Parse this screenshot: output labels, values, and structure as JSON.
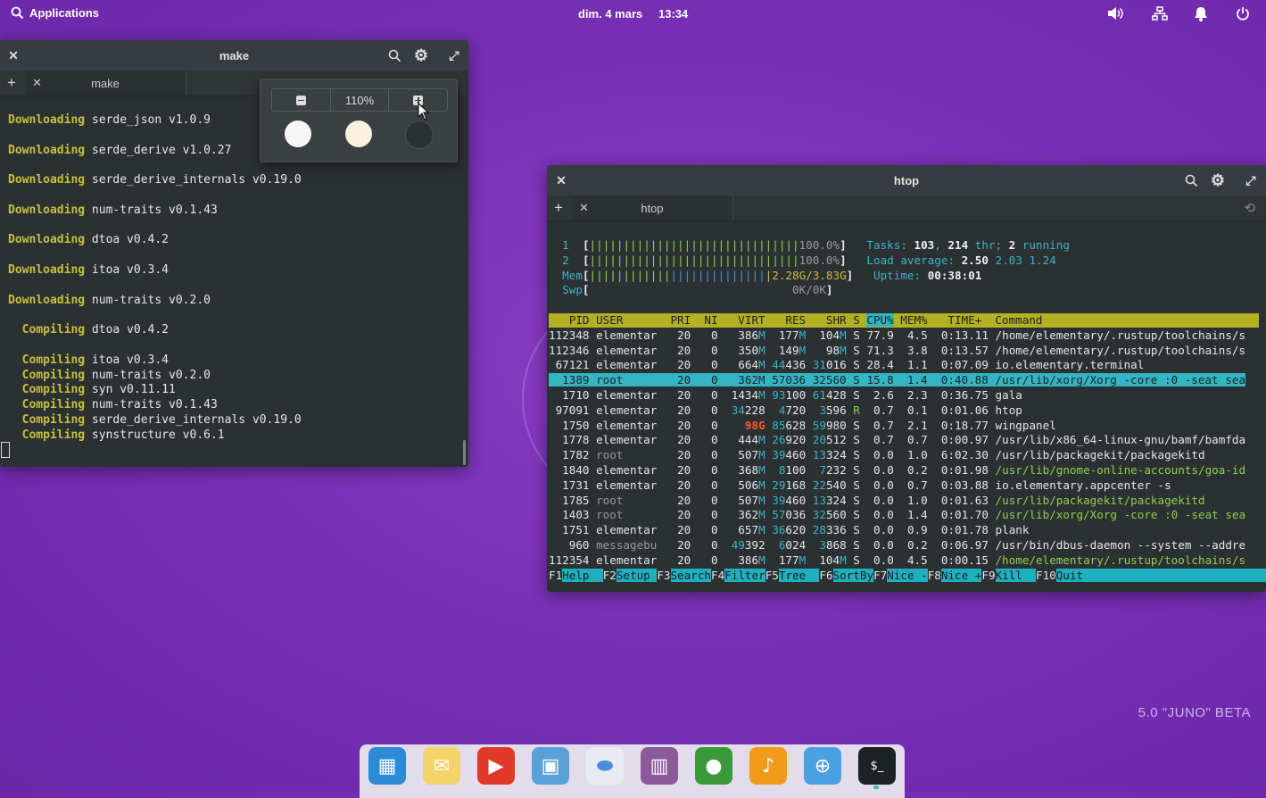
{
  "panel": {
    "applications": "Applications",
    "date": "dim. 4 mars",
    "time": "13:34"
  },
  "watermark": "5.0 \"JUNO\" BETA",
  "make_window": {
    "title": "make",
    "tab_label": "make",
    "zoom_value": "110%",
    "lines": [
      {
        "kw": "Downloading",
        "rest": " serde_json v1.0.9"
      },
      {
        "kw": "",
        "rest": ""
      },
      {
        "kw": "Downloading",
        "rest": " serde_derive v1.0.27"
      },
      {
        "kw": "",
        "rest": ""
      },
      {
        "kw": "Downloading",
        "rest": " serde_derive_internals v0.19.0"
      },
      {
        "kw": "",
        "rest": ""
      },
      {
        "kw": "Downloading",
        "rest": " num-traits v0.1.43"
      },
      {
        "kw": "",
        "rest": ""
      },
      {
        "kw": "Downloading",
        "rest": " dtoa v0.4.2"
      },
      {
        "kw": "",
        "rest": ""
      },
      {
        "kw": "Downloading",
        "rest": " itoa v0.3.4"
      },
      {
        "kw": "",
        "rest": ""
      },
      {
        "kw": "Downloading",
        "rest": " num-traits v0.2.0"
      },
      {
        "kw": "",
        "rest": ""
      },
      {
        "kw": "  Compiling",
        "rest": " dtoa v0.4.2"
      },
      {
        "kw": "",
        "rest": ""
      },
      {
        "kw": "  Compiling",
        "rest": " itoa v0.3.4"
      },
      {
        "kw": "  Compiling",
        "rest": " num-traits v0.2.0"
      },
      {
        "kw": "  Compiling",
        "rest": " syn v0.11.11"
      },
      {
        "kw": "  Compiling",
        "rest": " num-traits v0.1.43"
      },
      {
        "kw": "  Compiling",
        "rest": " serde_derive_internals v0.19.0"
      },
      {
        "kw": "  Compiling",
        "rest": " synstructure v0.6.1"
      }
    ],
    "swatches": [
      "#f7f7f7",
      "#fbf1dd",
      "#2b3033"
    ]
  },
  "htop_window": {
    "title": "htop",
    "tab_label": "htop",
    "cpu1": {
      "num": "1",
      "bars": "|||||||||||||||||||||||||||||||",
      "val": "100.0%"
    },
    "cpu2": {
      "num": "2",
      "bars": "|||||||||||||||||||||||||||||||",
      "val": "100.0%"
    },
    "mem": {
      "label": "Mem",
      "bars": "||||||||||||||||||||||||||",
      "val": "2.28G/3.83G"
    },
    "swp": {
      "label": "Swp",
      "val": "0K/0K"
    },
    "tasks": {
      "label": "Tasks: ",
      "n1": "103",
      "sep": ", ",
      "n2": "214",
      "thr": " thr; ",
      "n3": "2",
      "run": " running"
    },
    "load": {
      "label": "Load average: ",
      "a": "2.50",
      "b": "2.03",
      "c": "1.24"
    },
    "uptime": {
      "label": "Uptime: ",
      "val": "00:38:01"
    },
    "columns": {
      "pid": "PID",
      "user": "USER",
      "pri": "PRI",
      "ni": "NI",
      "virt": "VIRT",
      "res": "RES",
      "shr": "SHR",
      "s": "S",
      "cpu": "CPU%",
      "mem": "MEM%",
      "time": "TIME+",
      "cmd": "Command"
    },
    "rows": [
      {
        "pid": "112348",
        "user": "elementar",
        "pri": "20",
        "ni": "0",
        "virt": "386M",
        "res": "177M",
        "shr": "104M",
        "s": "S",
        "cpu": "77.9",
        "mem": "4.5",
        "time": "0:13.11",
        "cmd": "/home/elementary/.rustup/toolchains/s",
        "root": false
      },
      {
        "pid": "112346",
        "user": "elementar",
        "pri": "20",
        "ni": "0",
        "virt": "350M",
        "res": "149M",
        "shr": "98M",
        "s": "S",
        "cpu": "71.3",
        "mem": "3.8",
        "time": "0:13.57",
        "cmd": "/home/elementary/.rustup/toolchains/s",
        "root": false
      },
      {
        "pid": "67121",
        "user": "elementar",
        "pri": "20",
        "ni": "0",
        "virt": "664M",
        "res": "44436",
        "shr": "31016",
        "s": "S",
        "cpu": "28.4",
        "mem": "1.1",
        "time": "0:07.09",
        "cmd": "io.elementary.terminal",
        "root": false
      },
      {
        "pid": "1389",
        "user": "root",
        "pri": "20",
        "ni": "0",
        "virt": "362M",
        "res": "57036",
        "shr": "32560",
        "s": "S",
        "cpu": "15.8",
        "mem": "1.4",
        "time": "0:40.88",
        "cmd": "/usr/lib/xorg/Xorg -core :0 -seat sea",
        "root": true,
        "selected": true
      },
      {
        "pid": "1710",
        "user": "elementar",
        "pri": "20",
        "ni": "0",
        "virt": "1434M",
        "res": "93100",
        "shr": "61428",
        "s": "S",
        "cpu": "2.6",
        "mem": "2.3",
        "time": "0:36.75",
        "cmd": "gala",
        "root": false
      },
      {
        "pid": "97091",
        "user": "elementar",
        "pri": "20",
        "ni": "0",
        "virt": "34228",
        "res": "4720",
        "shr": "3596",
        "s": "R",
        "cpu": "0.7",
        "mem": "0.1",
        "time": "0:01.06",
        "cmd": "htop",
        "root": false
      },
      {
        "pid": "1750",
        "user": "elementar",
        "pri": "20",
        "ni": "0",
        "virt": "98G",
        "res": "85628",
        "shr": "59980",
        "s": "S",
        "cpu": "0.7",
        "mem": "2.1",
        "time": "0:18.77",
        "cmd": "wingpanel",
        "root": false,
        "bigvirt": true
      },
      {
        "pid": "1778",
        "user": "elementar",
        "pri": "20",
        "ni": "0",
        "virt": "444M",
        "res": "26920",
        "shr": "20512",
        "s": "S",
        "cpu": "0.7",
        "mem": "0.7",
        "time": "0:00.97",
        "cmd": "/usr/lib/x86_64-linux-gnu/bamf/bamfda",
        "root": false
      },
      {
        "pid": "1782",
        "user": "root",
        "pri": "20",
        "ni": "0",
        "virt": "507M",
        "res": "39460",
        "shr": "13324",
        "s": "S",
        "cpu": "0.0",
        "mem": "1.0",
        "time": "6:02.30",
        "cmd": "/usr/lib/packagekit/packagekitd",
        "root": true
      },
      {
        "pid": "1840",
        "user": "elementar",
        "pri": "20",
        "ni": "0",
        "virt": "368M",
        "res": "8100",
        "shr": "7232",
        "s": "S",
        "cpu": "0.0",
        "mem": "0.2",
        "time": "0:01.98",
        "cmd": "/usr/lib/gnome-online-accounts/goa-id",
        "root": false,
        "greencmd": true
      },
      {
        "pid": "1731",
        "user": "elementar",
        "pri": "20",
        "ni": "0",
        "virt": "506M",
        "res": "29168",
        "shr": "22540",
        "s": "S",
        "cpu": "0.0",
        "mem": "0.7",
        "time": "0:03.88",
        "cmd": "io.elementary.appcenter -s",
        "root": false
      },
      {
        "pid": "1785",
        "user": "root",
        "pri": "20",
        "ni": "0",
        "virt": "507M",
        "res": "39460",
        "shr": "13324",
        "s": "S",
        "cpu": "0.0",
        "mem": "1.0",
        "time": "0:01.63",
        "cmd": "/usr/lib/packagekit/packagekitd",
        "root": true,
        "greencmd": true
      },
      {
        "pid": "1403",
        "user": "root",
        "pri": "20",
        "ni": "0",
        "virt": "362M",
        "res": "57036",
        "shr": "32560",
        "s": "S",
        "cpu": "0.0",
        "mem": "1.4",
        "time": "0:01.70",
        "cmd": "/usr/lib/xorg/Xorg -core :0 -seat sea",
        "root": true,
        "greencmd": true
      },
      {
        "pid": "1751",
        "user": "elementar",
        "pri": "20",
        "ni": "0",
        "virt": "657M",
        "res": "36620",
        "shr": "28336",
        "s": "S",
        "cpu": "0.0",
        "mem": "0.9",
        "time": "0:01.78",
        "cmd": "plank",
        "root": false
      },
      {
        "pid": "960",
        "user": "messagebu",
        "pri": "20",
        "ni": "0",
        "virt": "49392",
        "res": "6024",
        "shr": "3868",
        "s": "S",
        "cpu": "0.0",
        "mem": "0.2",
        "time": "0:06.97",
        "cmd": "/usr/bin/dbus-daemon --system --addre",
        "root": true
      },
      {
        "pid": "112354",
        "user": "elementar",
        "pri": "20",
        "ni": "0",
        "virt": "386M",
        "res": "177M",
        "shr": "104M",
        "s": "S",
        "cpu": "0.0",
        "mem": "4.5",
        "time": "0:00.15",
        "cmd": "/home/elementary/.rustup/toolchains/s",
        "root": false,
        "greencmd": true
      }
    ],
    "fkeys": [
      {
        "k": "F1",
        "l": "Help  "
      },
      {
        "k": "F2",
        "l": "Setup "
      },
      {
        "k": "F3",
        "l": "Search"
      },
      {
        "k": "F4",
        "l": "Filter"
      },
      {
        "k": "F5",
        "l": "Tree  "
      },
      {
        "k": "F6",
        "l": "SortBy"
      },
      {
        "k": "F7",
        "l": "Nice -"
      },
      {
        "k": "F8",
        "l": "Nice +"
      },
      {
        "k": "F9",
        "l": "Kill  "
      },
      {
        "k": "F10",
        "l": "Quit"
      }
    ]
  },
  "dock": [
    {
      "name": "multitasking-view-icon",
      "color": "#2d8ad8"
    },
    {
      "name": "mail-icon",
      "color": "#f4d36a"
    },
    {
      "name": "videos-icon",
      "color": "#e23a2a"
    },
    {
      "name": "photos-icon",
      "color": "#5aa0d8"
    },
    {
      "name": "system-settings-icon",
      "color": "#e8ecf0"
    },
    {
      "name": "appcenter-icon",
      "color": "#8a5a9a"
    },
    {
      "name": "web-browser-icon",
      "color": "#3a9a3a"
    },
    {
      "name": "music-icon",
      "color": "#f29a1c"
    },
    {
      "name": "installer-icon",
      "color": "#4aa0e0"
    },
    {
      "name": "terminal-icon",
      "color": "#1d2224"
    }
  ]
}
